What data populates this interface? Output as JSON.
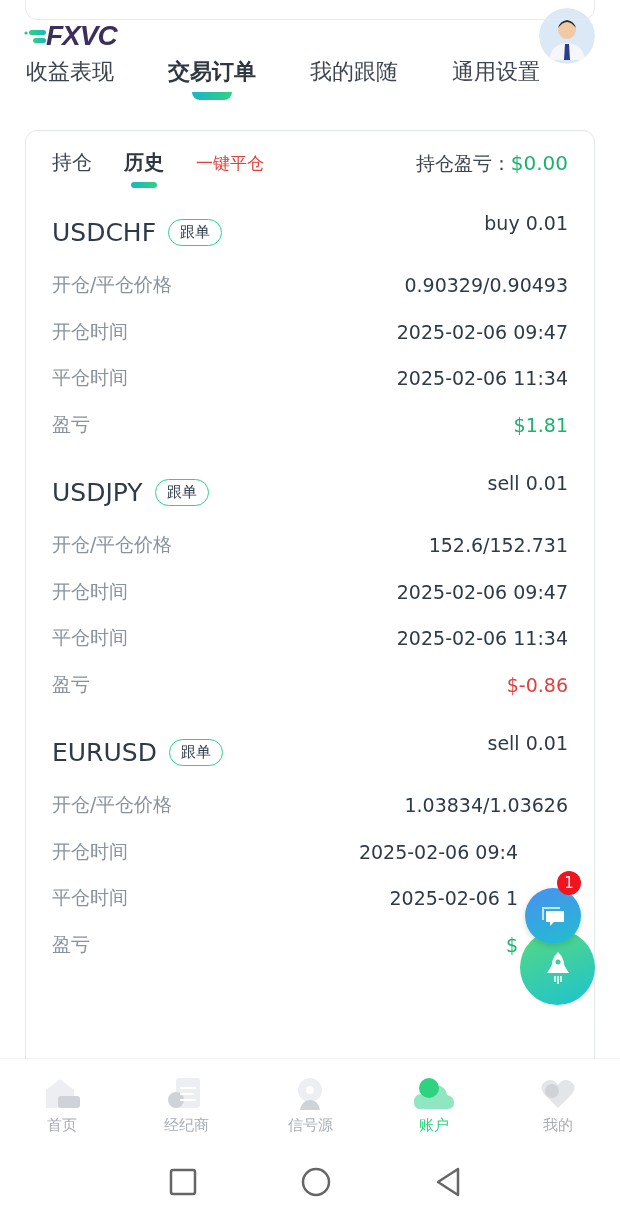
{
  "header": {
    "logo": "FXVC"
  },
  "tabs": [
    {
      "label": "收益表现",
      "selected": false
    },
    {
      "label": "交易订单",
      "selected": true
    },
    {
      "label": "我的跟随",
      "selected": false
    },
    {
      "label": "通用设置",
      "selected": false
    }
  ],
  "subtabs": [
    {
      "label": "持仓",
      "selected": false
    },
    {
      "label": "历史",
      "selected": true
    }
  ],
  "close_all": "一键平仓",
  "position_pnl": {
    "label": "持仓盈亏：",
    "value": "$0.00"
  },
  "orders": [
    {
      "symbol": "USDCHF",
      "tag": "跟单",
      "side": "buy 0.01",
      "rows": [
        {
          "label": "开仓/平仓价格",
          "value": "0.90329/0.90493"
        },
        {
          "label": "开仓时间",
          "value": "2025-02-06 09:47"
        },
        {
          "label": "平仓时间",
          "value": "2025-02-06 11:34"
        },
        {
          "label": "盈亏",
          "value": "$1.81",
          "kind": "profit"
        }
      ]
    },
    {
      "symbol": "USDJPY",
      "tag": "跟单",
      "side": "sell 0.01",
      "rows": [
        {
          "label": "开仓/平仓价格",
          "value": "152.6/152.731"
        },
        {
          "label": "开仓时间",
          "value": "2025-02-06 09:47"
        },
        {
          "label": "平仓时间",
          "value": "2025-02-06 11:34"
        },
        {
          "label": "盈亏",
          "value": "$-0.86",
          "kind": "loss"
        }
      ]
    },
    {
      "symbol": "EURUSD",
      "tag": "跟单",
      "side": "sell 0.01",
      "rows": [
        {
          "label": "开仓/平仓价格",
          "value": "1.03834/1.03626"
        },
        {
          "label": "开仓时间",
          "value": "2025-02-06 09:4"
        },
        {
          "label": "平仓时间",
          "value": "2025-02-06 1"
        },
        {
          "label": "盈亏",
          "value": "$",
          "kind": "profit"
        }
      ]
    }
  ],
  "chat_badge": "1",
  "bottom_nav": [
    {
      "label": "首页",
      "selected": false
    },
    {
      "label": "经纪商",
      "selected": false
    },
    {
      "label": "信号源",
      "selected": false
    },
    {
      "label": "账户",
      "selected": true
    },
    {
      "label": "我的",
      "selected": false
    }
  ]
}
